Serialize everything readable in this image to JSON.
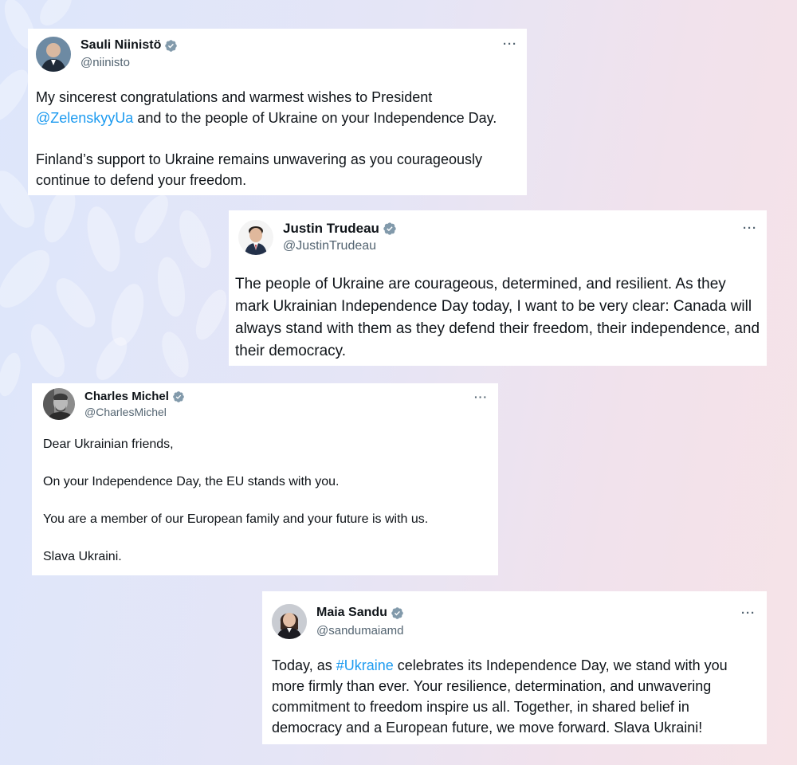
{
  "colors": {
    "link": "#1d9bf0",
    "verified_badge": "#829aab",
    "handle": "#536471",
    "text": "#0f1419",
    "card_background": "#ffffff"
  },
  "tweets": [
    {
      "name": "Sauli Niinistö",
      "handle": "@niinisto",
      "verified_icon": "verified-badge-icon",
      "more_icon": "more-options-icon",
      "more_label": "···",
      "paragraphs": [
        {
          "before": "My sincerest congratulations and warmest wishes to President ",
          "link": "@ZelenskyyUa",
          "after": " and to the people of Ukraine on your Independence Day."
        },
        {
          "text": "Finland’s support to Ukraine remains unwavering as you courageously continue to defend your freedom."
        }
      ]
    },
    {
      "name": "Justin Trudeau",
      "handle": "@JustinTrudeau",
      "verified_icon": "verified-badge-icon",
      "more_icon": "more-options-icon",
      "more_label": "···",
      "paragraphs": [
        {
          "text": "The people of Ukraine are courageous, determined, and resilient. As they mark Ukrainian Independence Day today, I want to be very clear: Canada will always stand with them as they defend their freedom, their independence, and their democracy."
        }
      ]
    },
    {
      "name": "Charles Michel",
      "handle": "@CharlesMichel",
      "verified_icon": "verified-badge-icon",
      "more_icon": "more-options-icon",
      "more_label": "···",
      "paragraphs": [
        {
          "text": "Dear Ukrainian friends,"
        },
        {
          "text": "On your Independence Day, the EU stands with you."
        },
        {
          "text": "You are a member of our European family and your future is with us."
        },
        {
          "text": "Slava Ukraini."
        }
      ]
    },
    {
      "name": "Maia Sandu",
      "handle": "@sandumaiamd",
      "verified_icon": "verified-badge-icon",
      "more_icon": "more-options-icon",
      "more_label": "···",
      "paragraphs": [
        {
          "before": "Today, as ",
          "link": "#Ukraine",
          "after": " celebrates its Independence Day, we stand with you more firmly than ever. Your resilience, determination, and unwavering commitment to freedom inspire us all. Together, in shared belief in democracy and a European future, we move forward. Slava Ukraini!"
        }
      ]
    }
  ]
}
